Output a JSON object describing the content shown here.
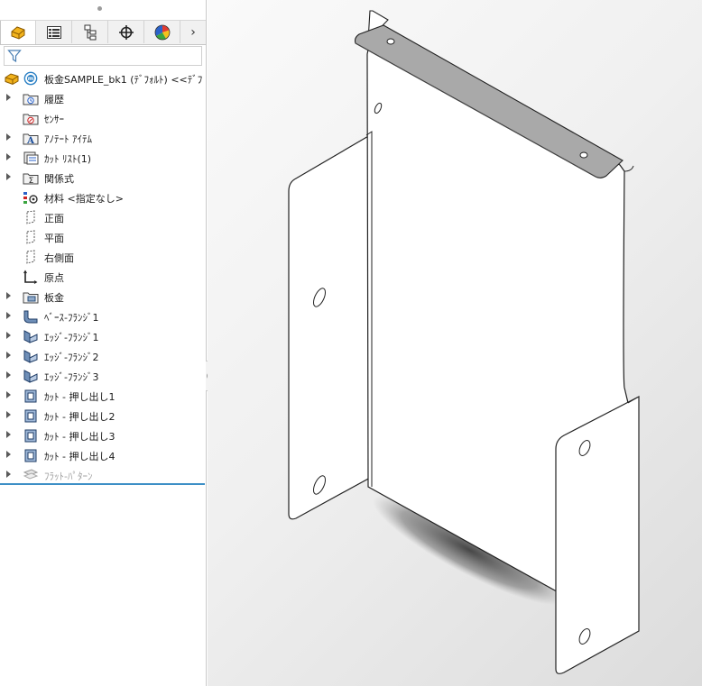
{
  "panel": {
    "tabs": [
      {
        "name": "feature-manager-icon",
        "active": true
      },
      {
        "name": "property-manager-icon",
        "active": false
      },
      {
        "name": "configuration-manager-icon",
        "active": false
      },
      {
        "name": "dimxpert-icon",
        "active": false
      },
      {
        "name": "appearance-icon",
        "active": false
      }
    ],
    "more_label": "›"
  },
  "tree": {
    "root": "板金SAMPLE_bk1 (ﾃﾞﾌｫﾙﾄ) <<ﾃﾞﾌ",
    "items": [
      {
        "label": "履歴",
        "icon": "history-folder-icon",
        "expand": true
      },
      {
        "label": "ｾﾝｻｰ",
        "icon": "sensor-folder-icon",
        "expand": false
      },
      {
        "label": "ｱﾉﾃｰﾄ ｱｲﾃﾑ",
        "icon": "annotation-icon",
        "expand": true
      },
      {
        "label": "ｶｯﾄ ﾘｽﾄ(1)",
        "icon": "cut-list-icon",
        "expand": true
      },
      {
        "label": "関係式",
        "icon": "equation-icon",
        "expand": true
      },
      {
        "label": "材料 <指定なし>",
        "icon": "material-icon",
        "expand": false
      },
      {
        "label": "正面",
        "icon": "plane-icon",
        "expand": false
      },
      {
        "label": "平面",
        "icon": "plane-icon",
        "expand": false
      },
      {
        "label": "右側面",
        "icon": "plane-icon",
        "expand": false
      },
      {
        "label": "原点",
        "icon": "origin-icon",
        "expand": false
      },
      {
        "label": "板金",
        "icon": "sheet-metal-icon",
        "expand": true
      },
      {
        "label": "ﾍﾞｰｽ-ﾌﾗﾝｼﾞ1",
        "icon": "base-flange-icon",
        "expand": true
      },
      {
        "label": "ｴｯｼﾞ-ﾌﾗﾝｼﾞ1",
        "icon": "edge-flange-icon",
        "expand": true
      },
      {
        "label": "ｴｯｼﾞ-ﾌﾗﾝｼﾞ2",
        "icon": "edge-flange-icon",
        "expand": true
      },
      {
        "label": "ｴｯｼﾞ-ﾌﾗﾝｼﾞ3",
        "icon": "edge-flange-icon",
        "expand": true
      },
      {
        "label": "ｶｯﾄ - 押し出し1",
        "icon": "extruded-cut-icon",
        "expand": true
      },
      {
        "label": "ｶｯﾄ - 押し出し2",
        "icon": "extruded-cut-icon",
        "expand": true
      },
      {
        "label": "ｶｯﾄ - 押し出し3",
        "icon": "extruded-cut-icon",
        "expand": true
      },
      {
        "label": "ｶｯﾄ - 押し出し4",
        "icon": "extruded-cut-icon",
        "expand": true
      },
      {
        "label": "ﾌﾗｯﾄ-ﾊﾟﾀｰﾝ",
        "icon": "flat-pattern-icon",
        "expand": true,
        "dim": true
      }
    ]
  }
}
